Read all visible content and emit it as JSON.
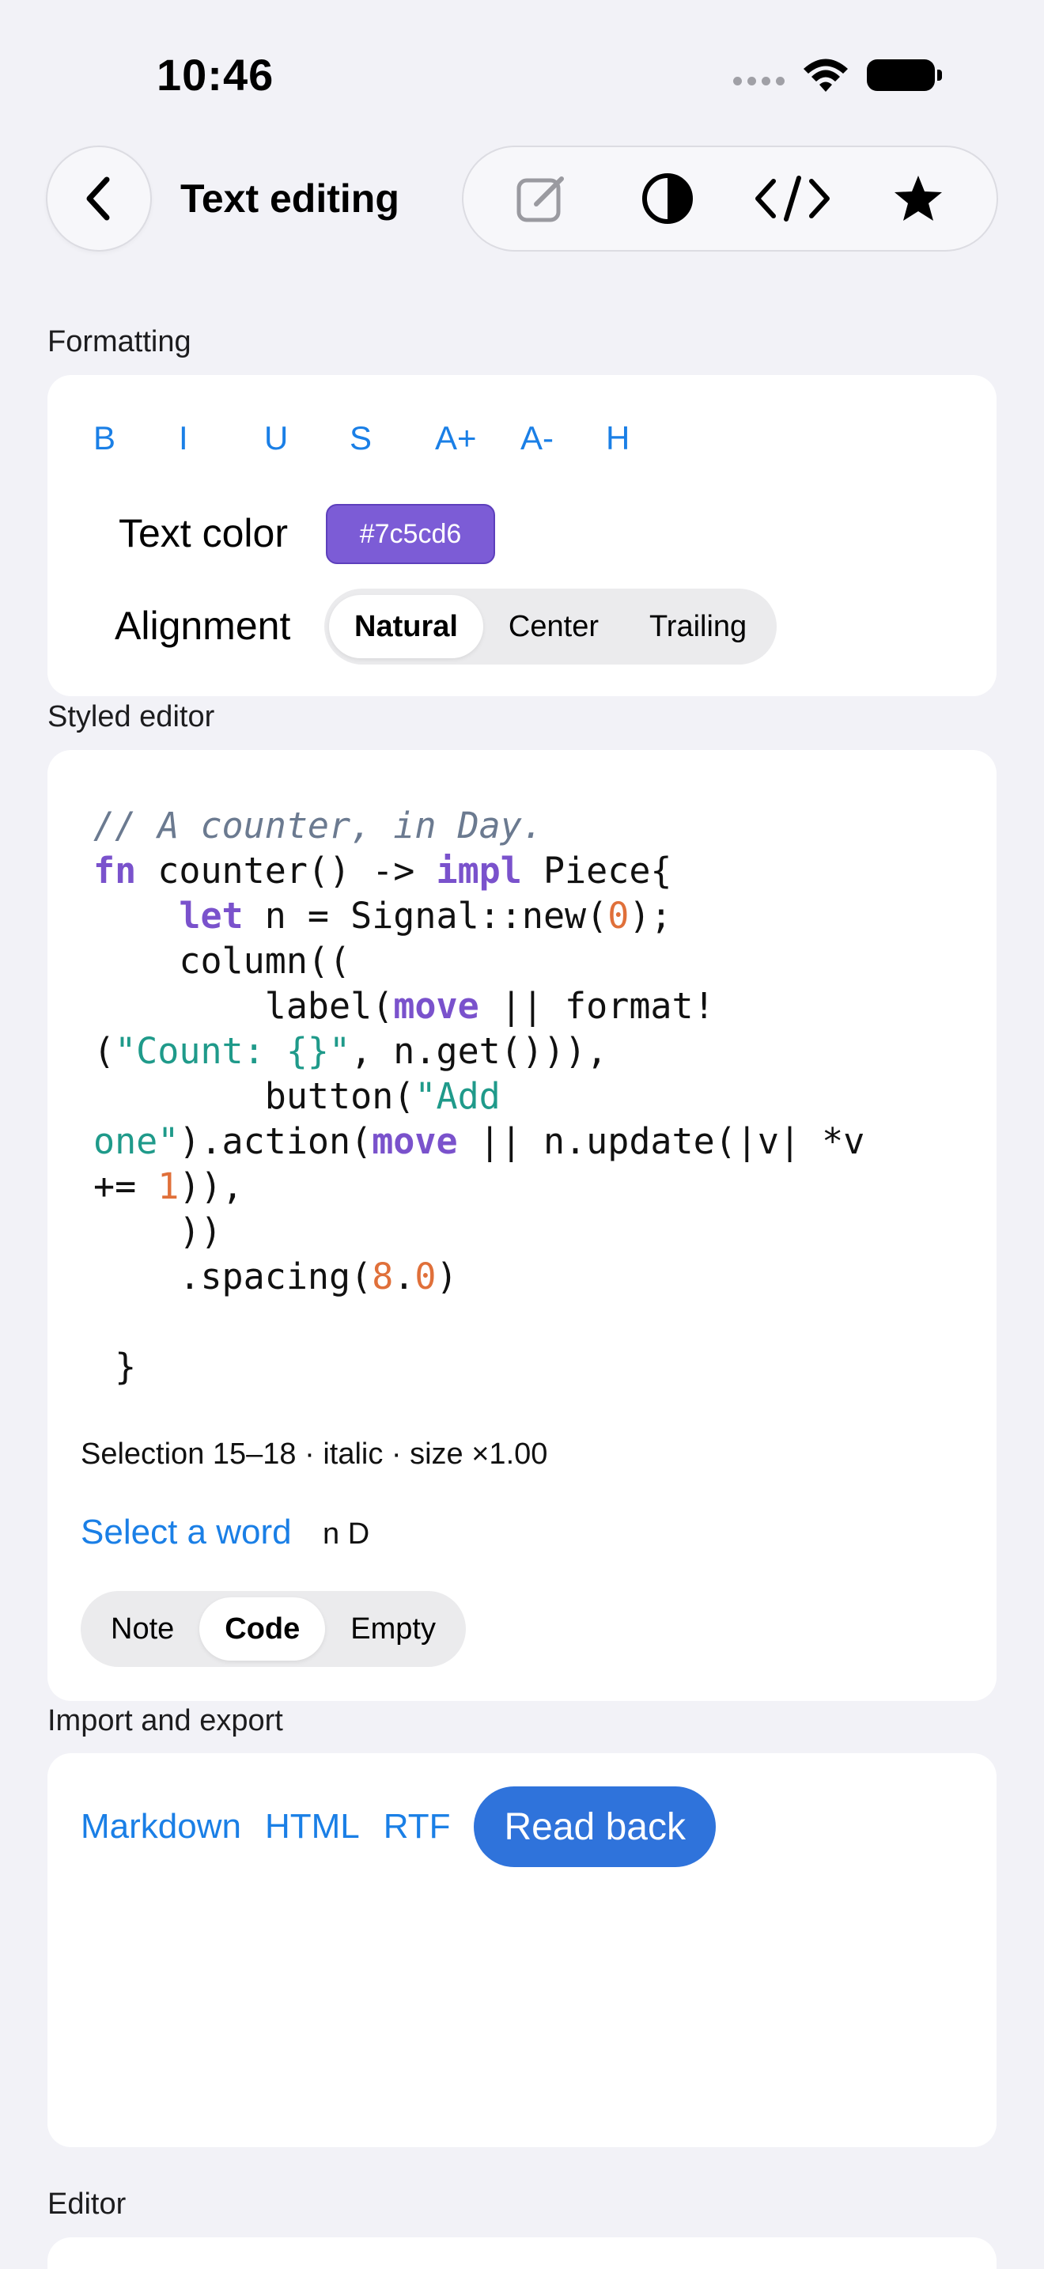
{
  "status": {
    "time": "10:46"
  },
  "nav": {
    "title": "Text editing",
    "toolbar": [
      "compose-icon",
      "contrast-icon",
      "code-icon",
      "star-icon"
    ]
  },
  "formatting": {
    "label": "Formatting",
    "buttons": [
      "B",
      "I",
      "U",
      "S",
      "A+",
      "A-",
      "H"
    ],
    "text_color_label": "Text color",
    "text_color_value": "#7c5cd6",
    "alignment_label": "Alignment",
    "alignment_options": [
      "Natural",
      "Center",
      "Trailing"
    ],
    "alignment_selected": "Natural"
  },
  "styled_editor": {
    "label": "Styled editor",
    "selection_info": "Selection 15–18 · italic · size ×1.00",
    "select_word_label": "Select a word",
    "select_word_output": "n D",
    "modes": [
      "Note",
      "Code",
      "Empty"
    ],
    "mode_selected": "Code",
    "code": {
      "comment": "// A counter, in Day.",
      "l2_kw": "fn",
      "l2_a": " counter() -> ",
      "l2_kw2": "impl",
      "l2_b": " Piece{",
      "l3_kw": "let",
      "l3_a": " n = Signal::new(",
      "l3_num": "0",
      "l3_b": ");",
      "l4": "column((",
      "l5_a": "label(",
      "l5_kw": "move",
      "l5_b": " || format!",
      "l6_str": "\"Count: {}\"",
      "l6_b": ", n.get())),",
      "l7_a": "button(",
      "l7_str": "\"Add",
      "l8_str": "one\"",
      "l8_a": ").action(",
      "l8_kw": "move",
      "l8_b": " || n.update(|v| *v",
      "l9_a": "+= ",
      "l9_num": "1",
      "l9_b": ")),",
      "l10": "))",
      "l11_a": ".spacing(",
      "l11_num1": "8",
      "l11_dot": ".",
      "l11_num2": "0",
      "l11_b": ")",
      "l13": "}"
    }
  },
  "import_export": {
    "label": "Import and export",
    "links": [
      "Markdown",
      "HTML",
      "RTF"
    ],
    "read_back": "Read back"
  },
  "editor": {
    "label": "Editor"
  }
}
